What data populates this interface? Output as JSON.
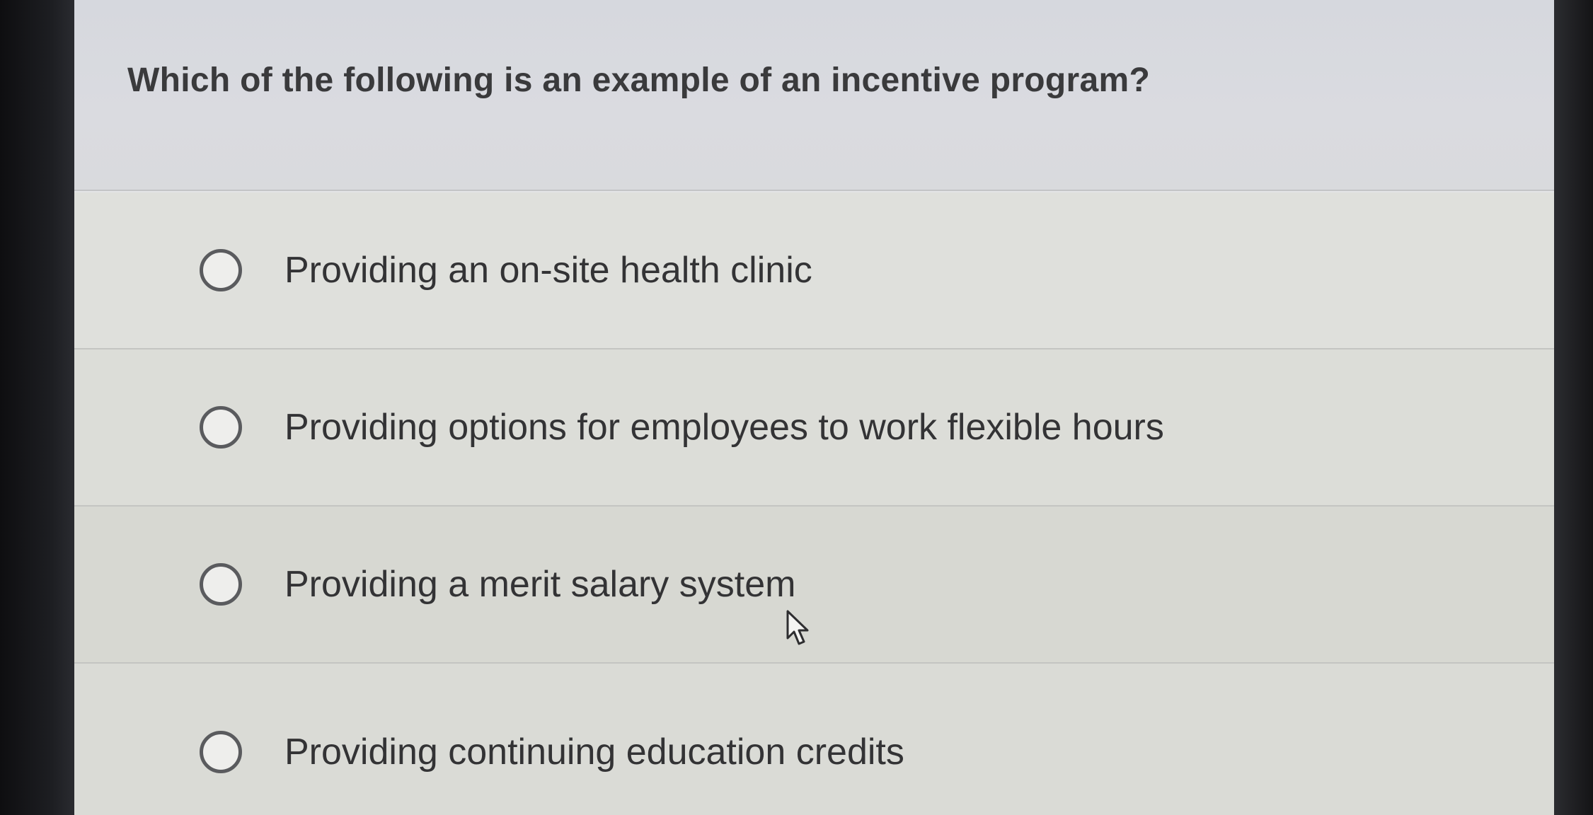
{
  "question": {
    "text": "Which of the following is an example of an incentive program?"
  },
  "options": [
    {
      "label": "Providing an on-site health clinic",
      "selected": false
    },
    {
      "label": "Providing options for employees to work flexible hours",
      "selected": false
    },
    {
      "label": "Providing a merit salary system",
      "selected": false
    },
    {
      "label": "Providing continuing education credits",
      "selected": false
    }
  ],
  "icons": {
    "radio": "radio-unchecked-icon",
    "cursor": "mouse-pointer-icon"
  },
  "colors": {
    "question_bg": "#d8d9de",
    "option_bg": "#dcddd8",
    "text": "#333335",
    "radio_border": "#5a5b5e"
  }
}
